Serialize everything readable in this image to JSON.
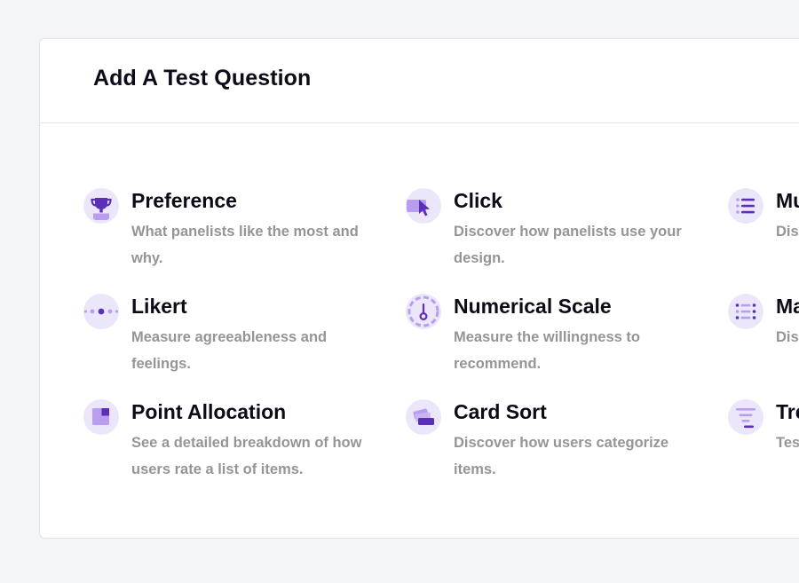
{
  "modal": {
    "title": "Add A Test Question"
  },
  "options": [
    {
      "title": "Preference",
      "description": "What panelists like the most and why.",
      "icon": "trophy-icon"
    },
    {
      "title": "Click",
      "description": "Discover how panelists use your design.",
      "icon": "cursor-click-icon"
    },
    {
      "title": "Mu",
      "description": "Dis wit",
      "icon": "list-icon"
    },
    {
      "title": "Likert",
      "description": "Measure agreeableness and feelings.",
      "icon": "likert-dots-icon"
    },
    {
      "title": "Numerical Scale",
      "description": "Measure the willingness to recommend.",
      "icon": "gauge-icon"
    },
    {
      "title": "Ma",
      "description": "Dis wo",
      "icon": "matrix-list-icon"
    },
    {
      "title": "Point Allocation",
      "description": "See a detailed breakdown of how users rate a list of items.",
      "icon": "point-allocation-icon"
    },
    {
      "title": "Card Sort",
      "description": "Discover how users categorize items.",
      "icon": "cards-icon"
    },
    {
      "title": "Tre",
      "description": "Tes a lis",
      "icon": "tree-filter-icon"
    }
  ],
  "colors": {
    "icon_background": "#ece6fb",
    "icon_primary": "#5b2fb8",
    "icon_secondary": "#b99ef0",
    "title_text": "#0c0b17",
    "description_text": "#959595",
    "page_background": "#f4f5f9"
  }
}
